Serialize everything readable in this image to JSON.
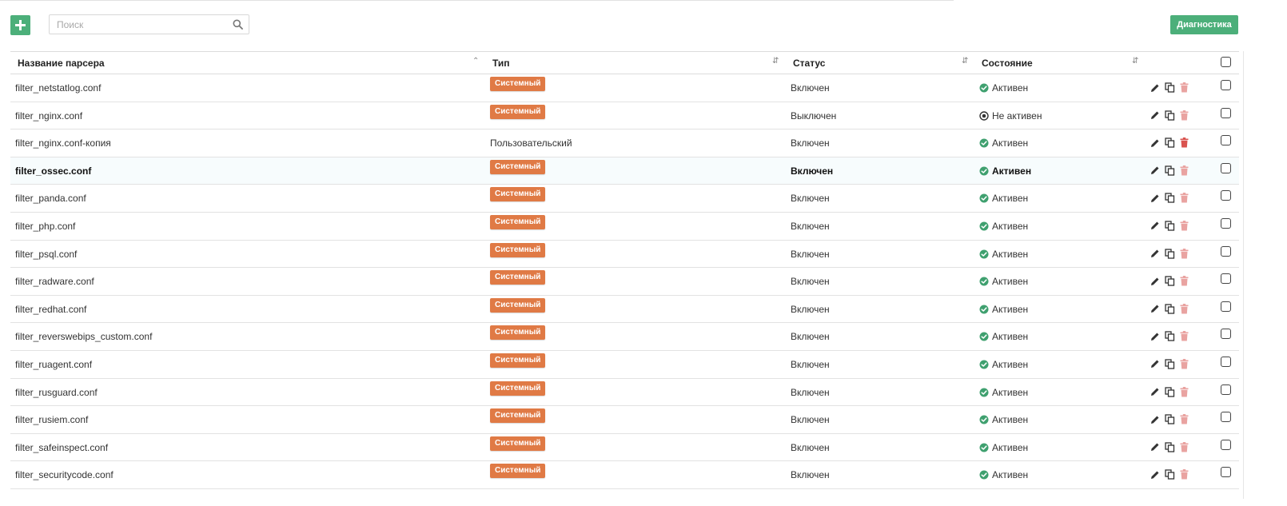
{
  "toolbar": {
    "search_placeholder": "Поиск",
    "diagnostics_label": "Диагностика",
    "accent_color": "#4caf7a"
  },
  "table": {
    "columns": {
      "name": "Название парсера",
      "type": "Тип",
      "status": "Статус",
      "state": "Состояние"
    },
    "rows": [
      {
        "name": "filter_netstatlog.conf",
        "type": "Системный",
        "type_badge": true,
        "status": "Включен",
        "state": "Активен",
        "state_icon": "check-circle-icon"
      },
      {
        "name": "filter_nginx.conf",
        "type": "Системный",
        "type_badge": true,
        "status": "Выключен",
        "state": "Не активен",
        "state_icon": "inactive-circle-icon"
      },
      {
        "name": "filter_nginx.conf-копия",
        "type": "Пользовательский",
        "type_badge": false,
        "status": "Включен",
        "state": "Активен",
        "state_icon": "check-circle-icon"
      },
      {
        "name": "filter_ossec.conf",
        "type": "Системный",
        "type_badge": true,
        "status": "Включен",
        "state": "Активен",
        "state_icon": "check-circle-icon"
      },
      {
        "name": "filter_panda.conf",
        "type": "Системный",
        "type_badge": true,
        "status": "Включен",
        "state": "Активен",
        "state_icon": "check-circle-icon"
      },
      {
        "name": "filter_php.conf",
        "type": "Системный",
        "type_badge": true,
        "status": "Включен",
        "state": "Активен",
        "state_icon": "check-circle-icon"
      },
      {
        "name": "filter_psql.conf",
        "type": "Системный",
        "type_badge": true,
        "status": "Включен",
        "state": "Активен",
        "state_icon": "check-circle-icon"
      },
      {
        "name": "filter_radware.conf",
        "type": "Системный",
        "type_badge": true,
        "status": "Включен",
        "state": "Активен",
        "state_icon": "check-circle-icon"
      },
      {
        "name": "filter_redhat.conf",
        "type": "Системный",
        "type_badge": true,
        "status": "Включен",
        "state": "Активен",
        "state_icon": "check-circle-icon"
      },
      {
        "name": "filter_reverswebips_custom.conf",
        "type": "Системный",
        "type_badge": true,
        "status": "Включен",
        "state": "Активен",
        "state_icon": "check-circle-icon"
      },
      {
        "name": "filter_ruagent.conf",
        "type": "Системный",
        "type_badge": true,
        "status": "Включен",
        "state": "Активен",
        "state_icon": "check-circle-icon"
      },
      {
        "name": "filter_rusguard.conf",
        "type": "Системный",
        "type_badge": true,
        "status": "Включен",
        "state": "Активен",
        "state_icon": "check-circle-icon"
      },
      {
        "name": "filter_rusiem.conf",
        "type": "Системный",
        "type_badge": true,
        "status": "Включен",
        "state": "Активен",
        "state_icon": "check-circle-icon"
      },
      {
        "name": "filter_safeinspect.conf",
        "type": "Системный",
        "type_badge": true,
        "status": "Включен",
        "state": "Активен",
        "state_icon": "check-circle-icon"
      },
      {
        "name": "filter_securitycode.conf",
        "type": "Системный",
        "type_badge": true,
        "status": "Включен",
        "state": "Активен",
        "state_icon": "check-circle-icon"
      }
    ],
    "badge_color": "#e07a45",
    "active_color": "#3fa06f",
    "delete_enabled_color": "#d9534f",
    "delete_disabled_color": "#e9a3a1",
    "highlighted_row_index": 3
  }
}
